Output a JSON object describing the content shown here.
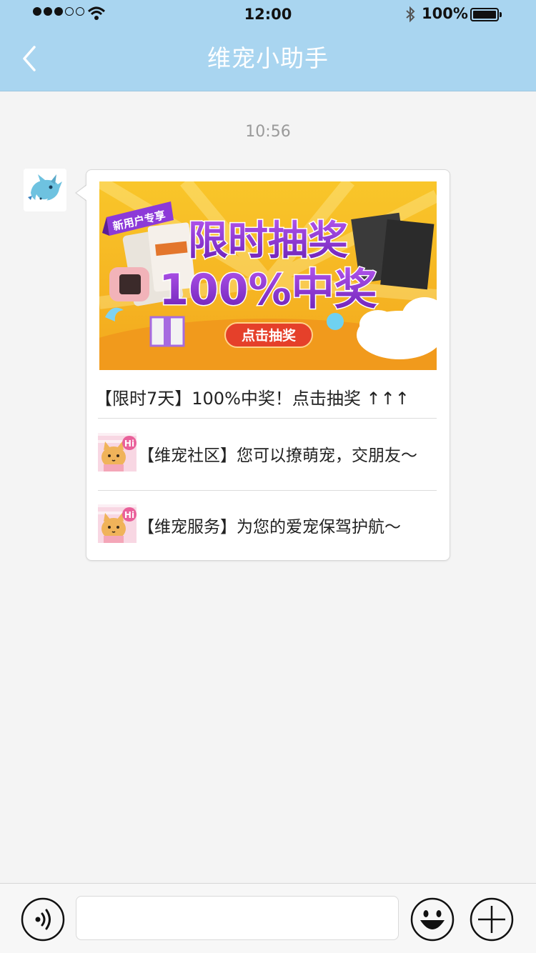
{
  "status_bar": {
    "time": "12:00",
    "battery": "100%"
  },
  "nav": {
    "title": "维宠小助手"
  },
  "chat": {
    "timestamp": "10:56",
    "card": {
      "banner": {
        "tag": "新用户专享",
        "title_line1": "限时抽奖",
        "title_line2": "100%中奖",
        "button": "点击抽奖"
      },
      "headline": "【限时7天】100%中奖！点击抽奖 ↑↑↑",
      "links": [
        {
          "label": "【维宠社区】您可以撩萌宠，交朋友～",
          "badge": "Hi"
        },
        {
          "label": "【维宠服务】为您的爱宠保驾护航～",
          "badge": "Hi"
        }
      ]
    }
  },
  "input_bar": {
    "placeholder": ""
  },
  "colors": {
    "header": "#a9d5f0",
    "background": "#f4f4f4",
    "banner_bg": "#f6b821",
    "banner_title": "#8a2bd6"
  }
}
